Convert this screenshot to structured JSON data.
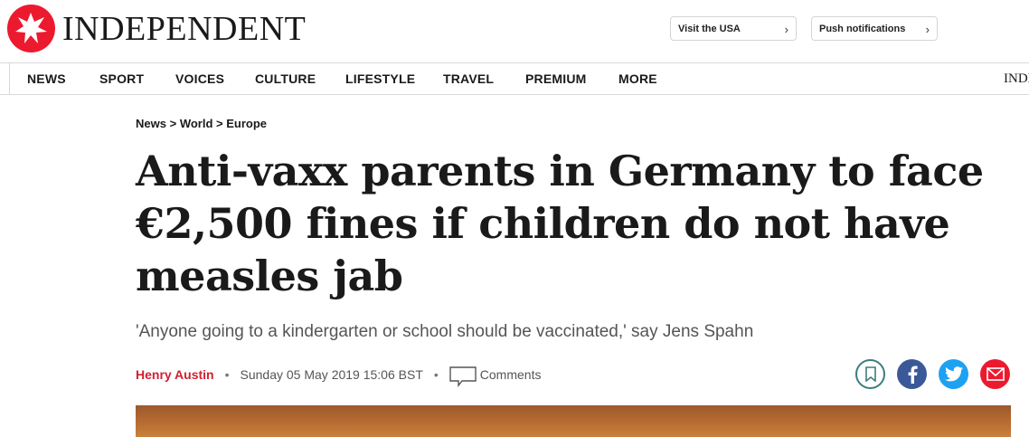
{
  "header": {
    "brand_name": "INDEPENDENT",
    "brand_color": "#ec1a2e",
    "buttons": [
      {
        "label": "Visit the USA",
        "icon": "chevron-right-icon"
      },
      {
        "label": "Push notifications",
        "icon": "chevron-right-icon"
      }
    ]
  },
  "nav": {
    "items": [
      "NEWS",
      "SPORT",
      "VOICES",
      "CULTURE",
      "LIFESTYLE",
      "TRAVEL",
      "PREMIUM",
      "MORE"
    ],
    "brand_truncated": "INDEPENDENT"
  },
  "article": {
    "breadcrumbs": [
      "News",
      "World",
      "Europe"
    ],
    "breadcrumb_separator": ">",
    "headline": "Anti-vaxx parents in Germany to face €2,500 fines if children do not have measles jab",
    "standfirst": "'Anyone going to a kindergarten or school should be vaccinated,' say Jens Spahn",
    "author": "Henry Austin",
    "date": "Sunday 05 May 2019 15:06 BST",
    "comments_label": "Comments",
    "byline_separator": "•",
    "author_color": "#d1202f"
  },
  "share": {
    "icons": [
      "bookmark-icon",
      "facebook-icon",
      "twitter-icon",
      "email-icon"
    ],
    "colors": {
      "facebook": "#3b5998",
      "twitter": "#1da1f2",
      "email": "#ec1a2e",
      "bookmark": "#3c7c7e"
    }
  }
}
